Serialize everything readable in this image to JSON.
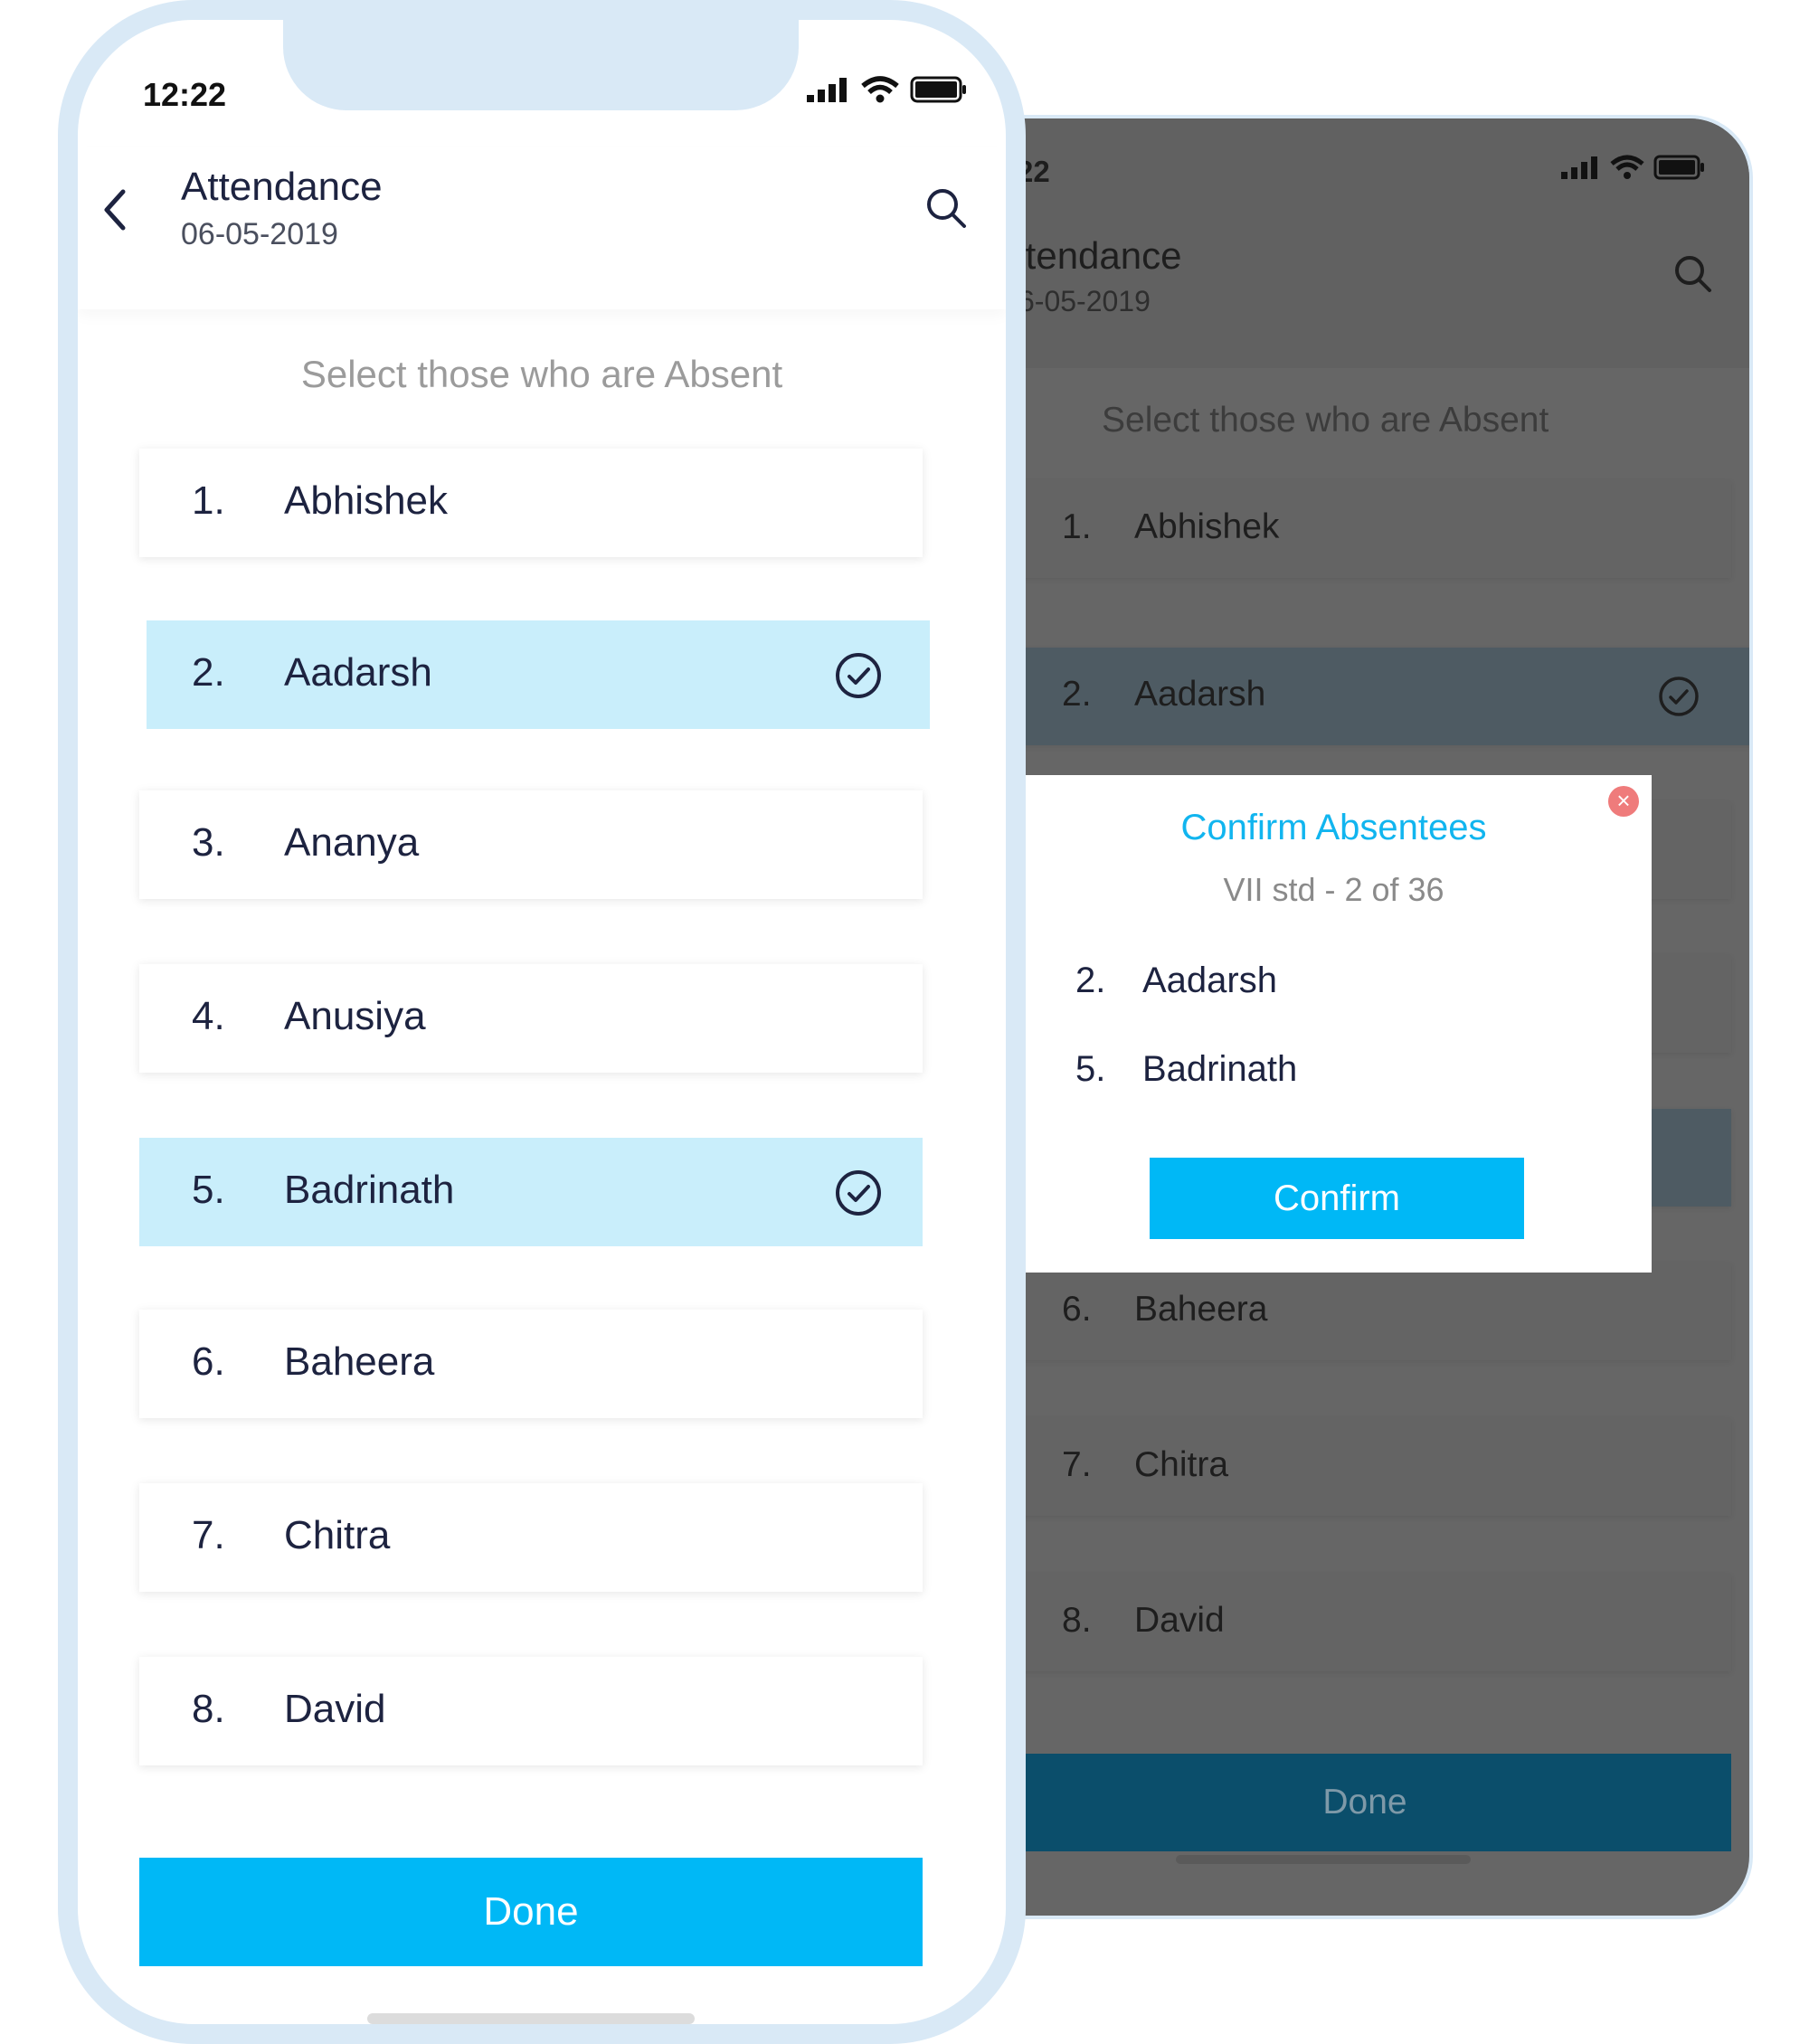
{
  "back_screen": {
    "time": "22",
    "header": {
      "title": "ttendance",
      "date": "6-05-2019"
    },
    "hint": "Select those who are Absent",
    "rows": [
      {
        "num": "1.",
        "name": "Abhishek"
      },
      {
        "num": "2.",
        "name": "Aadarsh"
      },
      {
        "num": "6.",
        "name": "Baheera"
      },
      {
        "num": "7.",
        "name": "Chitra"
      },
      {
        "num": "8.",
        "name": "David"
      }
    ],
    "done_label": "Done"
  },
  "modal": {
    "title": "Confirm Absentees",
    "subtitle": "VII std - 2 of 36",
    "items": [
      {
        "num": "2.",
        "name": "Aadarsh"
      },
      {
        "num": "5.",
        "name": "Badrinath"
      }
    ],
    "confirm_label": "Confirm"
  },
  "front_screen": {
    "time": "12:22",
    "header": {
      "title": "Attendance",
      "date": "06-05-2019"
    },
    "hint": "Select those who are Absent",
    "rows": [
      {
        "num": "1.",
        "name": "Abhishek",
        "selected": false
      },
      {
        "num": "2.",
        "name": "Aadarsh",
        "selected": true
      },
      {
        "num": "3.",
        "name": "Ananya",
        "selected": false
      },
      {
        "num": "4.",
        "name": "Anusiya",
        "selected": false
      },
      {
        "num": "5.",
        "name": "Badrinath",
        "selected": true
      },
      {
        "num": "6.",
        "name": "Baheera",
        "selected": false
      },
      {
        "num": "7.",
        "name": "Chitra",
        "selected": false
      },
      {
        "num": "8.",
        "name": "David",
        "selected": false
      }
    ],
    "done_label": "Done"
  },
  "icons": {
    "back": "chevron-left-icon",
    "search": "search-icon",
    "check": "check-circle-icon",
    "signal": "signal-icon",
    "wifi": "wifi-icon",
    "battery": "battery-icon",
    "close": "close-icon"
  },
  "colors": {
    "accent": "#00b8f6",
    "selected_row": "#c9eefb",
    "frame": "#d9e9f6",
    "modal_title": "#11b5ef",
    "close_button": "#ef7b7b"
  }
}
